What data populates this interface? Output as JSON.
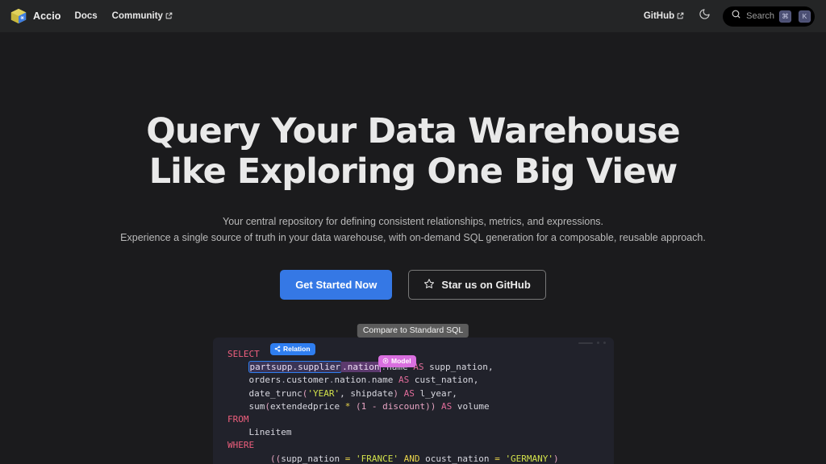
{
  "navbar": {
    "brand": {
      "name": "Accio",
      "logo_icon": "cube-logo-icon"
    },
    "links": [
      {
        "label": "Docs",
        "external": false
      },
      {
        "label": "Community",
        "external": true
      }
    ],
    "right_links": [
      {
        "label": "GitHub",
        "external": true
      }
    ],
    "theme_toggle_icon": "moon-icon",
    "search": {
      "icon": "search-icon",
      "placeholder": "Search",
      "shortcut_keys": [
        "⌘",
        "K"
      ]
    }
  },
  "hero": {
    "title_line1": "Query Your Data Warehouse",
    "title_line2": "Like Exploring One Big View",
    "subtitle_line1": "Your central repository for defining consistent relationships, metrics, and expressions.",
    "subtitle_line2": "Experience a single source of truth in your data warehouse, with on-demand SQL generation for a composable, reusable approach.",
    "primary_button": "Get Started Now",
    "secondary_button": "Star us on GitHub",
    "secondary_button_icon": "star-icon"
  },
  "code_section": {
    "compare_tab": "Compare to Standard SQL",
    "badges": {
      "relation": {
        "label": "Relation",
        "icon": "share-nodes-icon",
        "color": "#2f7ef0"
      },
      "model": {
        "label": "Model",
        "icon": "model-circle-icon",
        "color": "#d96fdf"
      }
    },
    "code_lines": [
      "SELECT",
      "    partsupp.supplier.nation.name AS supp_nation,",
      "    orders.customer.nation.name AS cust_nation,",
      "    date_trunc('YEAR', shipdate) AS l_year,",
      "    sum(extendedprice * (1 - discount)) AS volume",
      "FROM",
      "    Lineitem",
      "WHERE",
      "        ((supp_nation = 'FRANCE' AND ocust_nation = 'GERMANY')"
    ],
    "tokens": {
      "select": "SELECT",
      "from": "FROM",
      "where": "WHERE",
      "as": "AS",
      "and": "AND",
      "highlight_relation": "partsupp.supplier",
      "highlight_model": ".nation",
      "table": "Lineitem",
      "strings": [
        "'YEAR'",
        "'FRANCE'",
        "'GERMANY'"
      ],
      "aliases": [
        "supp_nation",
        "cust_nation",
        "l_year",
        "volume"
      ]
    }
  },
  "colors": {
    "page_bg": "#1b1b1d",
    "navbar_bg": "#242526",
    "code_bg": "#21222b",
    "accent_blue": "#3578e5",
    "badge_blue": "#2f7ef0",
    "badge_pink": "#d96fdf",
    "keyword_pink": "#ef5f7d",
    "string_yellow": "#d2e14b"
  }
}
